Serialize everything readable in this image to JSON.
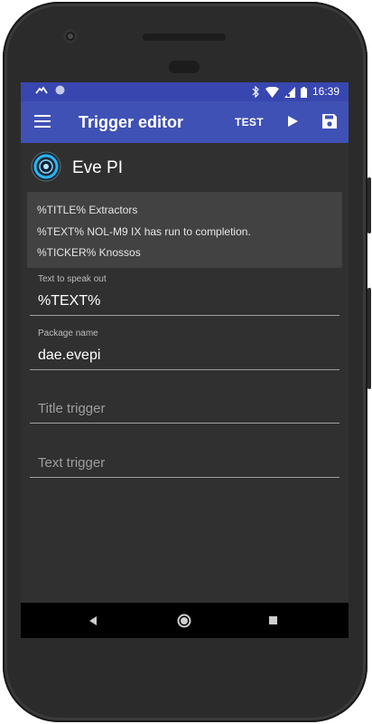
{
  "status_bar": {
    "time": "16:39"
  },
  "app_bar": {
    "title": "Trigger editor",
    "test_label": "TEST"
  },
  "app": {
    "name": "Eve PI"
  },
  "notification": {
    "line1": "%TITLE% Extractors",
    "line2": "%TEXT% NOL-M9 IX has run to completion.",
    "line3": "%TICKER% Knossos"
  },
  "fields": {
    "speak": {
      "label": "Text to speak out",
      "value": "%TEXT%"
    },
    "package": {
      "label": "Package name",
      "value": "dae.evepi"
    },
    "title_trigger": {
      "placeholder": "Title trigger"
    },
    "text_trigger": {
      "placeholder": "Text trigger"
    }
  },
  "colors": {
    "primary": "#3f51b5",
    "primary_dark": "#3847b0",
    "background": "#303030",
    "card": "#424242"
  },
  "icons": [
    "menu-icon",
    "play-icon",
    "save-icon",
    "back-icon",
    "home-icon",
    "recents-icon"
  ]
}
